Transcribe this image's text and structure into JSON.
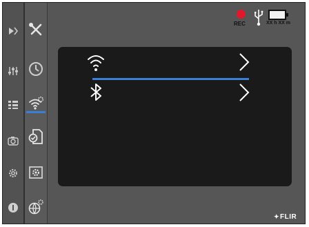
{
  "status": {
    "rec_label": "REC",
    "battery_label": "XX h XX m",
    "rec_color": "#e0182a"
  },
  "logo": {
    "text": "FLIR"
  },
  "sidebar_primary": [
    {
      "icon": "play-icon"
    },
    {
      "icon": "sliders-icon"
    },
    {
      "icon": "list-icon"
    },
    {
      "icon": "camera-icon"
    },
    {
      "icon": "gear-icon"
    },
    {
      "icon": "info-icon"
    }
  ],
  "sidebar_secondary": [
    {
      "icon": "tools-icon"
    },
    {
      "icon": "clock-icon"
    },
    {
      "icon": "wifi-settings-icon",
      "active": true
    },
    {
      "icon": "document-check-icon"
    },
    {
      "icon": "image-settings-icon"
    },
    {
      "icon": "globe-settings-icon"
    }
  ],
  "menu": {
    "items": [
      {
        "icon": "wifi-icon",
        "selected": true
      },
      {
        "icon": "bluetooth-icon",
        "selected": false
      }
    ]
  },
  "colors": {
    "accent": "#3a80d6",
    "panel": "#1a1a1a",
    "background": "#565656"
  }
}
